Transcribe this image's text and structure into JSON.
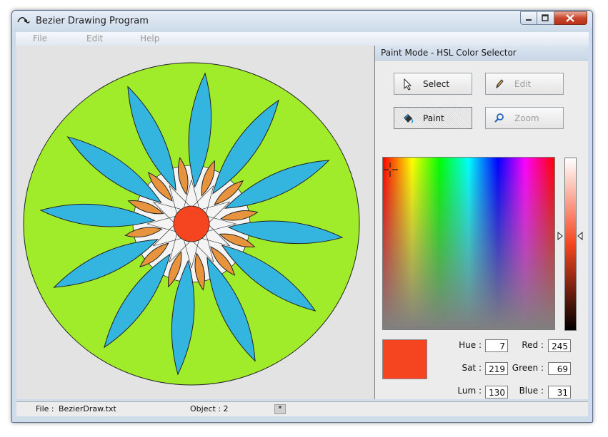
{
  "window": {
    "title": "Bezier Drawing Program"
  },
  "menu": {
    "file": "File",
    "edit": "Edit",
    "help": "Help"
  },
  "panel": {
    "title": "Paint Mode - HSL Color Selector",
    "tools": {
      "select": "Select",
      "edit": "Edit",
      "paint": "Paint",
      "zoom": "Zoom"
    },
    "fields": {
      "hue_label": "Hue :",
      "hue": "7",
      "sat_label": "Sat :",
      "sat": "219",
      "lum_label": "Lum :",
      "lum": "130",
      "red_label": "Red :",
      "red": "245",
      "green_label": "Green :",
      "green": "69",
      "blue_label": "Blue :",
      "blue": "31"
    },
    "selected_color": "#f54520"
  },
  "status": {
    "file_label": "File  :",
    "file_name": "BezierDraw.txt",
    "object": "Object : 2",
    "grip": "*"
  },
  "colors": {
    "background_circle": "#a0ec2b",
    "outer_petal": "#34b5e0",
    "inner_petal": "#e8943e",
    "center": "#f54520"
  }
}
